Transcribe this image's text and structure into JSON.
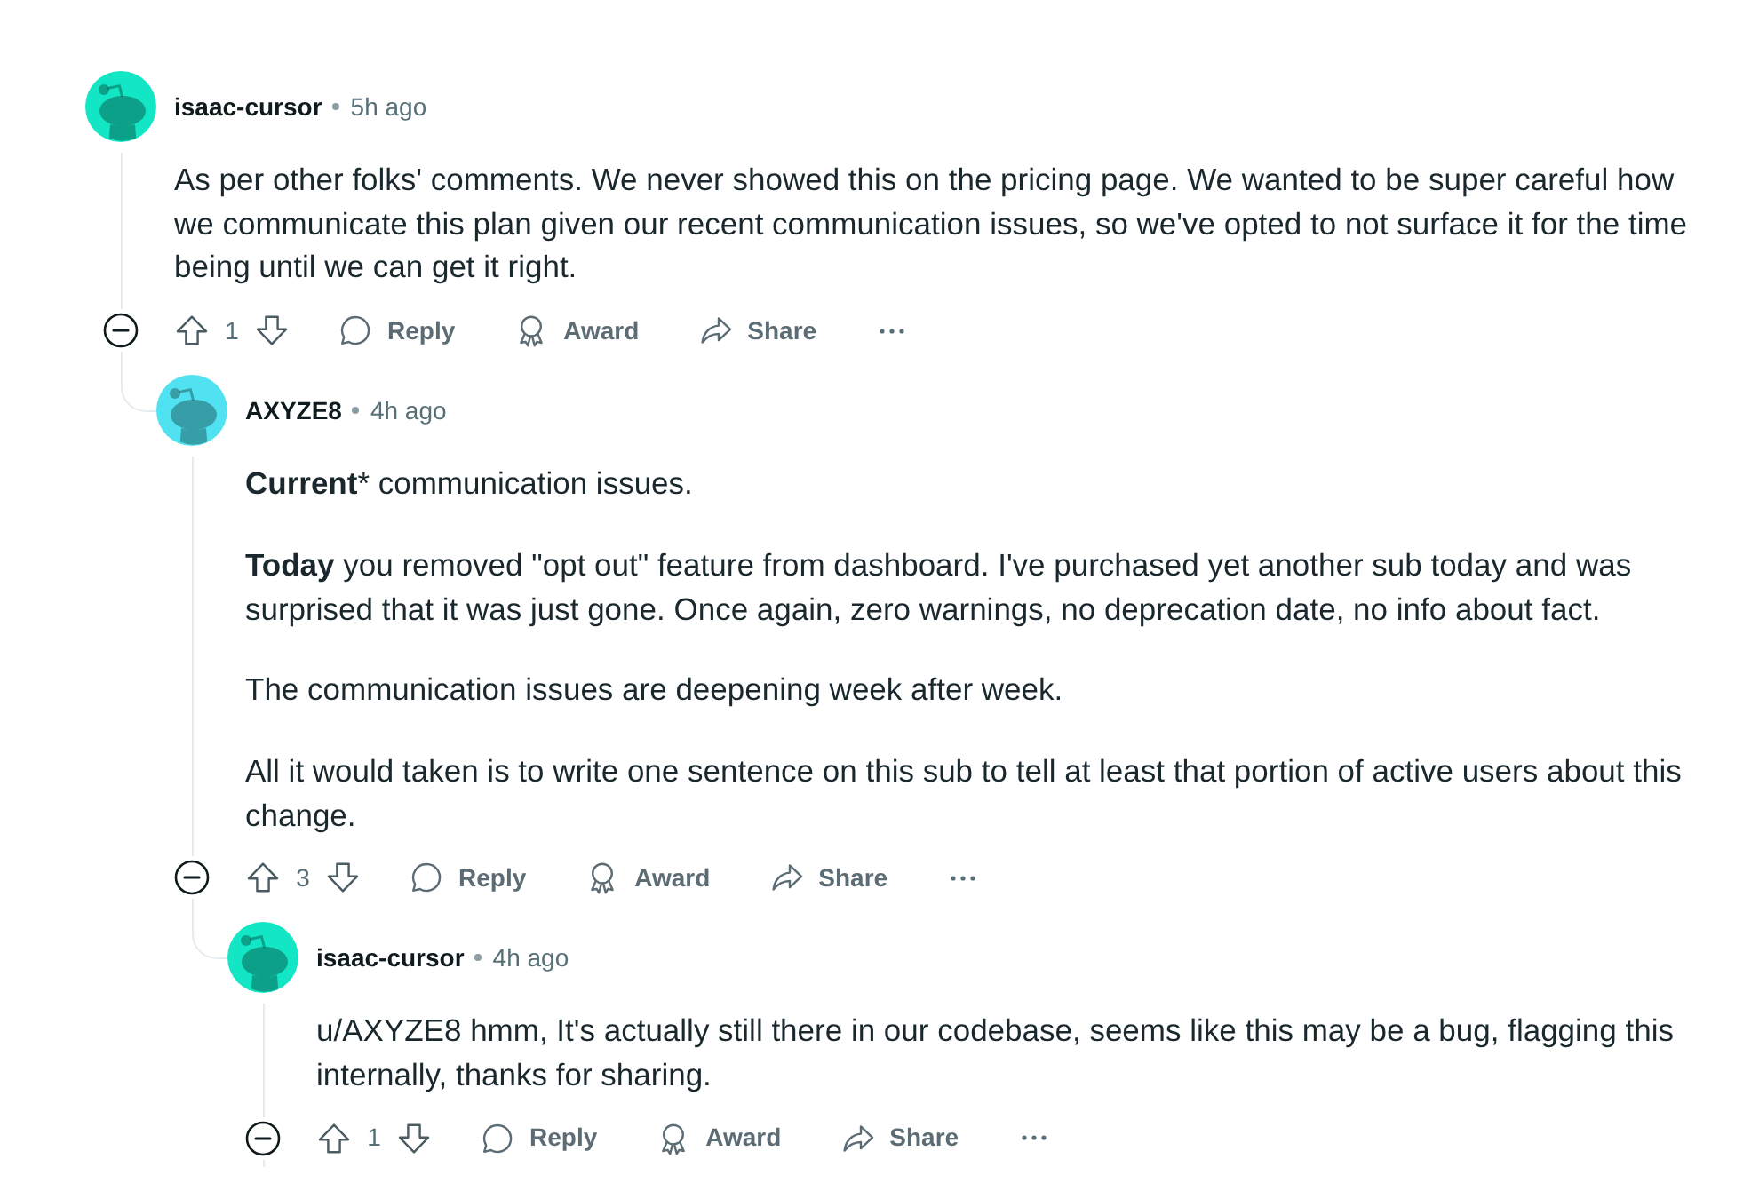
{
  "comments": [
    {
      "author": "isaac-cursor",
      "age": "5h ago",
      "color": "#13e6c4",
      "paragraphs": [
        "As per other folks' comments. We never showed this on the pricing page. We wanted to be super careful how we communicate this plan given our recent communication issues, so we've opted to not surface it for the time being until we can get it right."
      ],
      "score": "1",
      "actions": [
        {
          "kind": "reply",
          "label": "Reply"
        },
        {
          "kind": "award",
          "label": "Award"
        },
        {
          "kind": "share",
          "label": "Share"
        }
      ],
      "replies": [
        {
          "author": "AXYZE8",
          "age": "4h ago",
          "color": "#50e2f0",
          "paragraphs": [
            "**Current*** communication issues.",
            "**Today** you removed \"opt out\" feature from dashboard. I've purchased yet another sub today and was surprised that it was just gone. Once again, zero warnings, no deprecation date, no info about fact.",
            "The communication issues are deepening week after week.",
            "All it would taken is to write one sentence on this sub to tell at least that portion of active users about this change."
          ],
          "score": "3",
          "actions": [
            {
              "kind": "reply",
              "label": "Reply"
            },
            {
              "kind": "award",
              "label": "Award"
            },
            {
              "kind": "share",
              "label": "Share"
            }
          ],
          "replies": [
            {
              "author": "isaac-cursor",
              "age": "4h ago",
              "color": "#13e6c4",
              "paragraphs": [
                "u/AXYZE8 hmm, It's actually still there in our codebase, seems like this may be a bug, flagging this internally, thanks for sharing."
              ],
              "score": "1",
              "actions": [
                {
                  "kind": "reply",
                  "label": "Reply"
                },
                {
                  "kind": "award",
                  "label": "Award"
                },
                {
                  "kind": "share",
                  "label": "Share"
                }
              ]
            }
          ]
        }
      ]
    }
  ]
}
